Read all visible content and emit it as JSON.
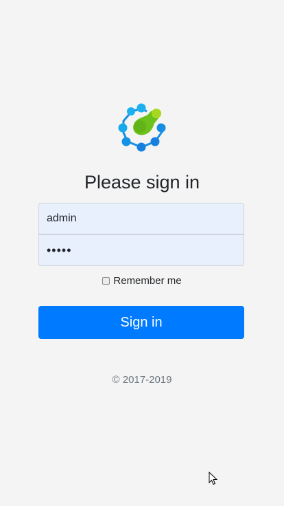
{
  "logo": {
    "icon": "app-logo-icon",
    "colors": {
      "ring": "#1aa3e8",
      "ring_dark": "#1477d6",
      "center": "#6cc11c",
      "center_light": "#a5d920"
    }
  },
  "form": {
    "title": "Please sign in",
    "username_value": "admin",
    "username_placeholder": "",
    "password_value": "•••••",
    "remember_label": "Remember me",
    "remember_checked": false,
    "submit_label": "Sign in"
  },
  "footer": {
    "copyright": "© 2017-2019"
  },
  "colors": {
    "primary": "#007bff",
    "input_background": "#e8f0fe",
    "page_background": "#f4f4f4"
  },
  "cursor": {
    "icon": "mouse-pointer-icon"
  }
}
